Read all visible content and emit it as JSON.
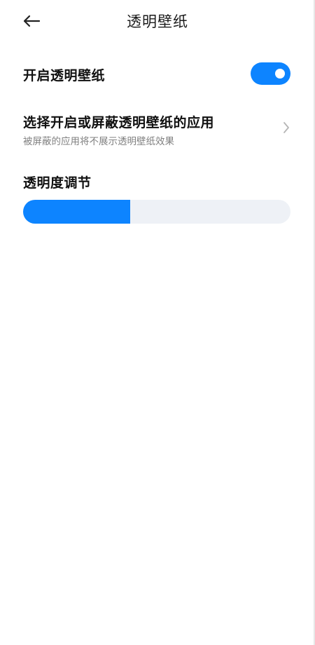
{
  "header": {
    "title": "透明壁纸",
    "back_icon": "back-arrow-icon"
  },
  "toggle_row": {
    "label": "开启透明壁纸",
    "enabled": true
  },
  "apps_row": {
    "title": "选择开启或屏蔽透明壁纸的应用",
    "subtitle": "被屏蔽的应用将不展示透明壁纸效果",
    "chevron_icon": "chevron-right-icon"
  },
  "opacity": {
    "label": "透明度调节",
    "value_fraction": 0.4
  },
  "colors": {
    "accent": "#0d84ff",
    "track": "#eef1f6",
    "title_text": "#1b1b1b",
    "subtitle_text": "#808080"
  }
}
